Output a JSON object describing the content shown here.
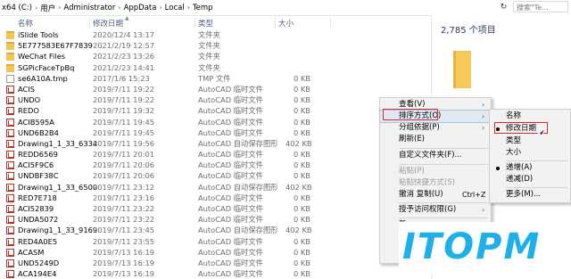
{
  "address": {
    "crumbs": [
      "x64 (C:)",
      "用户",
      "Administrator",
      "AppData",
      "Local",
      "Temp"
    ],
    "search_placeholder": "搜索\"Te..."
  },
  "columns": {
    "name": "名称",
    "date": "修改日期",
    "type": "类型",
    "size": "大小"
  },
  "files": [
    {
      "name": "iSlide Tools",
      "date": "2020/12/4 13:17",
      "type": "文件夹",
      "size": "",
      "icon": "folder"
    },
    {
      "name": "5E777583E67F7839",
      "date": "2021/2/19 12:57",
      "type": "文件夹",
      "size": "",
      "icon": "folder"
    },
    {
      "name": "WeChat Files",
      "date": "2021/2/23 13:26",
      "type": "文件夹",
      "size": "",
      "icon": "folder"
    },
    {
      "name": "SGPicFaceTpBq",
      "date": "2021/2/23 14:41",
      "type": "文件夹",
      "size": "",
      "icon": "folder"
    },
    {
      "name": "se6A10A.tmp",
      "date": "2017/1/6 15:23",
      "type": "TMP 文件",
      "size": "0 KB",
      "icon": "file"
    },
    {
      "name": "ACIS",
      "date": "2019/7/11 19:22",
      "type": "AutoCAD 临时文件",
      "size": "0 KB",
      "icon": "cad"
    },
    {
      "name": "UNDO",
      "date": "2019/7/11 19:22",
      "type": "AutoCAD 临时文件",
      "size": "0 KB",
      "icon": "cad"
    },
    {
      "name": "REDO",
      "date": "2019/7/11 19:32",
      "type": "AutoCAD 临时文件",
      "size": "0 KB",
      "icon": "cad"
    },
    {
      "name": "ACIB595A",
      "date": "2019/7/11 19:45",
      "type": "AutoCAD 临时文件",
      "size": "0 KB",
      "icon": "cad"
    },
    {
      "name": "UND6B2B4",
      "date": "2019/7/11 19:45",
      "type": "AutoCAD 临时文件",
      "size": "0 KB",
      "icon": "cad"
    },
    {
      "name": "Drawing1_1_33_6334",
      "date": "2019/7/11 19:56",
      "type": "AutoCAD 自动保存图形",
      "size": "402 KB",
      "icon": "cad"
    },
    {
      "name": "REDD6569",
      "date": "2019/7/11 20:01",
      "type": "AutoCAD 临时文件",
      "size": "0 KB",
      "icon": "cad"
    },
    {
      "name": "ACI5F9C6",
      "date": "2019/7/11 20:06",
      "type": "AutoCAD 临时文件",
      "size": "0 KB",
      "icon": "cad"
    },
    {
      "name": "UNDBF38C",
      "date": "2019/7/11 20:06",
      "type": "AutoCAD 临时文件",
      "size": "0 KB",
      "icon": "cad"
    },
    {
      "name": "Drawing1_1_33_6500",
      "date": "2019/7/11 23:12",
      "type": "AutoCAD 自动保存图形",
      "size": "402 KB",
      "icon": "cad"
    },
    {
      "name": "RED7E718",
      "date": "2019/7/11 23:16",
      "type": "AutoCAD 临时文件",
      "size": "0 KB",
      "icon": "cad"
    },
    {
      "name": "ACI52839",
      "date": "2019/7/11 23:22",
      "type": "AutoCAD 临时文件",
      "size": "0 KB",
      "icon": "cad"
    },
    {
      "name": "UNDA5072",
      "date": "2019/7/11 23:22",
      "type": "AutoCAD 临时文件",
      "size": "0 KB",
      "icon": "cad"
    },
    {
      "name": "Drawing1_1_33_9169",
      "date": "2019/7/11 23:45",
      "type": "AutoCAD 自动保存图形",
      "size": "402 KB",
      "icon": "cad"
    },
    {
      "name": "RED4A0E5",
      "date": "2019/7/11 23:55",
      "type": "AutoCAD 临时文件",
      "size": "0 KB",
      "icon": "cad"
    },
    {
      "name": "ACASM",
      "date": "2019/7/13 16:19",
      "type": "AutoCAD 临时文件",
      "size": "0 KB",
      "icon": "cad"
    },
    {
      "name": "UND5249D",
      "date": "2019/7/13 16:19",
      "type": "AutoCAD 临时文件",
      "size": "0 KB",
      "icon": "cad"
    },
    {
      "name": "ACA194E4",
      "date": "2019/7/13 16:19",
      "type": "AutoCAD 临时文件",
      "size": "0 KB",
      "icon": "cad"
    }
  ],
  "panel": {
    "count": "2,785 个项目"
  },
  "menu": {
    "items": [
      {
        "label": "查看(V)",
        "arrow": true
      },
      {
        "label": "排序方式(O)",
        "arrow": true
      },
      {
        "label": "分组依据(P)",
        "arrow": true
      },
      {
        "label": "刷新(E)"
      },
      {
        "label": "自定义文件夹(F)..."
      },
      {
        "label": "粘贴(P)",
        "disabled": true
      },
      {
        "label": "粘贴快捷方式(S)",
        "disabled": true
      },
      {
        "label": "撤消 复制(U)",
        "shortcut": "Ctrl+Z"
      },
      {
        "label": "授予访问权限(G)",
        "arrow": true
      },
      {
        "label": "新"
      },
      {
        "label": "属"
      }
    ]
  },
  "submenu": {
    "items": [
      {
        "label": "名称"
      },
      {
        "label": "修改日期"
      },
      {
        "label": "类型"
      },
      {
        "label": "大小"
      },
      {
        "label": "递增(A)"
      },
      {
        "label": "递减(D)"
      },
      {
        "label": "更多(M)..."
      }
    ]
  },
  "watermark": "ITOPM",
  "colors": {
    "accent": "#20b0e8",
    "highlight": "#e22a2a",
    "folder": "#f3c64f"
  }
}
